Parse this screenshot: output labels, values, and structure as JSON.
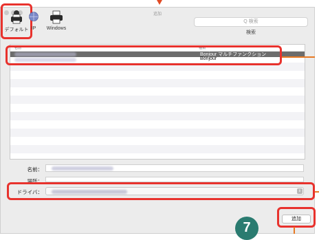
{
  "window": {
    "title": "追加"
  },
  "toolbar": {
    "default_label": "デフォルト",
    "ip_label": "IP",
    "windows_label": "Windows",
    "search_placeholder": "Q 検索",
    "search_caption": "検索"
  },
  "list": {
    "columns": [
      "名前",
      "種類"
    ],
    "rows": [
      {
        "name": "",
        "kind": "Bonjour マルチファンクション",
        "selected": true
      },
      {
        "name": "",
        "kind": "Bonjour",
        "selected": false
      }
    ]
  },
  "form": {
    "name_label": "名前：",
    "location_label": "場所：",
    "driver_label": "ドライバ："
  },
  "buttons": {
    "add_label": "追加"
  },
  "annotation": {
    "step_number": "7"
  },
  "colors": {
    "highlight": "#e8322d",
    "callout_line": "#e87922",
    "step_badge": "#2a7b70",
    "selected_row": "#6c6c6c"
  }
}
